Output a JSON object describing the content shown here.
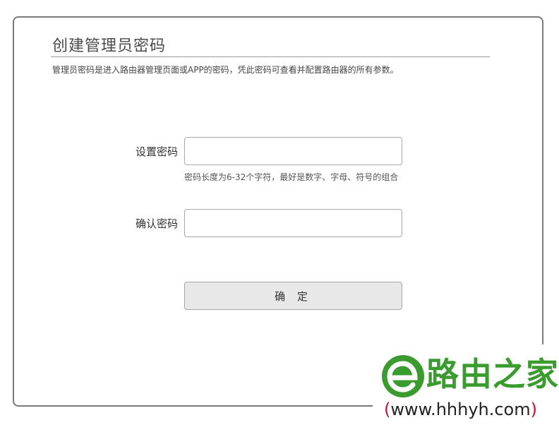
{
  "form": {
    "title": "创建管理员密码",
    "description": "管理员密码是进入路由器管理页面或APP的密码，凭此密码可查看并配置路由器的所有参数。",
    "set_password_label": "设置密码",
    "set_password_value": "",
    "password_hint": "密码长度为6-32个字符，最好是数字、字母、符号的组合",
    "confirm_password_label": "确认密码",
    "confirm_password_value": "",
    "confirm_button_label": "确 定"
  },
  "watermark": {
    "site_name": "路由之家",
    "url_open": "(",
    "url_text": "www.hhhyh.com",
    "url_close": ")",
    "brand_color": "#3a9b2e",
    "logo_icon": "green-e-logo-icon"
  }
}
